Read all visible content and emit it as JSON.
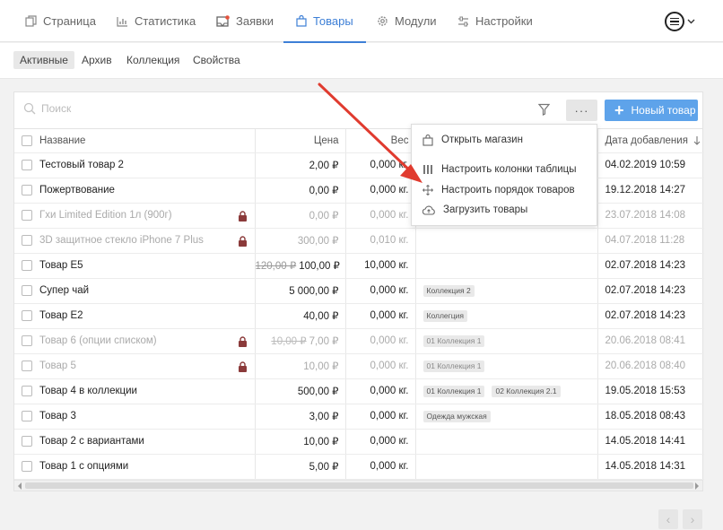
{
  "nav": {
    "tabs": [
      {
        "label": "Страница",
        "icon": "pages-icon"
      },
      {
        "label": "Статистика",
        "icon": "chart-icon"
      },
      {
        "label": "Заявки",
        "icon": "orders-icon"
      },
      {
        "label": "Товары",
        "icon": "bag-icon"
      },
      {
        "label": "Модули",
        "icon": "gear-icon"
      },
      {
        "label": "Настройки",
        "icon": "sliders-icon"
      }
    ],
    "active_tab": "Товары"
  },
  "subnav": {
    "items": [
      "Активные",
      "Архив",
      "Коллекция",
      "Свойства"
    ],
    "active": "Активные"
  },
  "toolbar": {
    "search_placeholder": "Поиск",
    "more_label": "···",
    "new_button_label": "Новый товар"
  },
  "table": {
    "columns": {
      "name": "Название",
      "price": "Цена",
      "weight": "Вес",
      "tags": "",
      "date": "Дата добавления"
    },
    "rows": [
      {
        "name": "Тестовый товар 2",
        "old_price": "",
        "price": "2,00 ₽",
        "weight": "0,000 кг.",
        "tags": [],
        "date": "04.02.2019 10:59",
        "dim": false,
        "locked": false
      },
      {
        "name": "Пожертвование",
        "old_price": "",
        "price": "0,00 ₽",
        "weight": "0,000 кг.",
        "tags": [],
        "date": "19.12.2018 14:27",
        "dim": false,
        "locked": false
      },
      {
        "name": "Гхи Limited Edition 1л (900г)",
        "old_price": "",
        "price": "0,00 ₽",
        "weight": "0,000 кг.",
        "tags": [],
        "date": "23.07.2018 14:08",
        "dim": true,
        "locked": true
      },
      {
        "name": "3D защитное стекло iPhone 7 Plus",
        "old_price": "",
        "price": "300,00 ₽",
        "weight": "0,010 кг.",
        "tags": [],
        "date": "04.07.2018 11:28",
        "dim": true,
        "locked": true
      },
      {
        "name": "Товар E5",
        "old_price": "120,00 ₽",
        "price": "100,00 ₽",
        "weight": "10,000 кг.",
        "tags": [],
        "date": "02.07.2018 14:23",
        "dim": false,
        "locked": false
      },
      {
        "name": "Супер чай",
        "old_price": "",
        "price": "5 000,00 ₽",
        "weight": "0,000 кг.",
        "tags": [
          "Коллекция 2"
        ],
        "date": "02.07.2018 14:23",
        "dim": false,
        "locked": false
      },
      {
        "name": "Товар E2",
        "old_price": "",
        "price": "40,00 ₽",
        "weight": "0,000 кг.",
        "tags": [
          "Коллегция"
        ],
        "date": "02.07.2018 14:23",
        "dim": false,
        "locked": false
      },
      {
        "name": "Товар 6 (опции списком)",
        "old_price": "10,00 ₽",
        "price": "7,00 ₽",
        "weight": "0,000 кг.",
        "tags": [
          "01 Коллекция 1"
        ],
        "date": "20.06.2018 08:41",
        "dim": true,
        "locked": true
      },
      {
        "name": "Товар 5",
        "old_price": "",
        "price": "10,00 ₽",
        "weight": "0,000 кг.",
        "tags": [
          "01 Коллекция 1"
        ],
        "date": "20.06.2018 08:40",
        "dim": true,
        "locked": true
      },
      {
        "name": "Товар 4 в коллекции",
        "old_price": "",
        "price": "500,00 ₽",
        "weight": "0,000 кг.",
        "tags": [
          "01 Коллекция 1",
          "02 Коллекция 2.1"
        ],
        "date": "19.05.2018 15:53",
        "dim": false,
        "locked": false
      },
      {
        "name": "Товар 3",
        "old_price": "",
        "price": "3,00 ₽",
        "weight": "0,000 кг.",
        "tags": [
          "Одежда мужская"
        ],
        "date": "18.05.2018 08:43",
        "dim": false,
        "locked": false
      },
      {
        "name": "Товар 2 с вариантами",
        "old_price": "",
        "price": "10,00 ₽",
        "weight": "0,000 кг.",
        "tags": [],
        "date": "14.05.2018 14:41",
        "dim": false,
        "locked": false
      },
      {
        "name": "Товар 1 с опциями",
        "old_price": "",
        "price": "5,00 ₽",
        "weight": "0,000 кг.",
        "tags": [],
        "date": "14.05.2018 14:31",
        "dim": false,
        "locked": false
      }
    ]
  },
  "dropdown": {
    "items": [
      {
        "label": "Открыть магазин",
        "icon": "bag-icon"
      },
      {
        "label": "Настроить колонки таблицы",
        "icon": "columns-icon"
      },
      {
        "label": "Настроить порядок товаров",
        "icon": "move-icon"
      },
      {
        "label": "Загрузить товары",
        "icon": "cloud-upload-icon"
      }
    ]
  },
  "pager": {
    "prev": "‹",
    "next": "›"
  },
  "colors": {
    "accent": "#3d7fd6",
    "button": "#5ea3ea",
    "arrow": "#e03b2f",
    "lock": "#8b3a3a"
  }
}
